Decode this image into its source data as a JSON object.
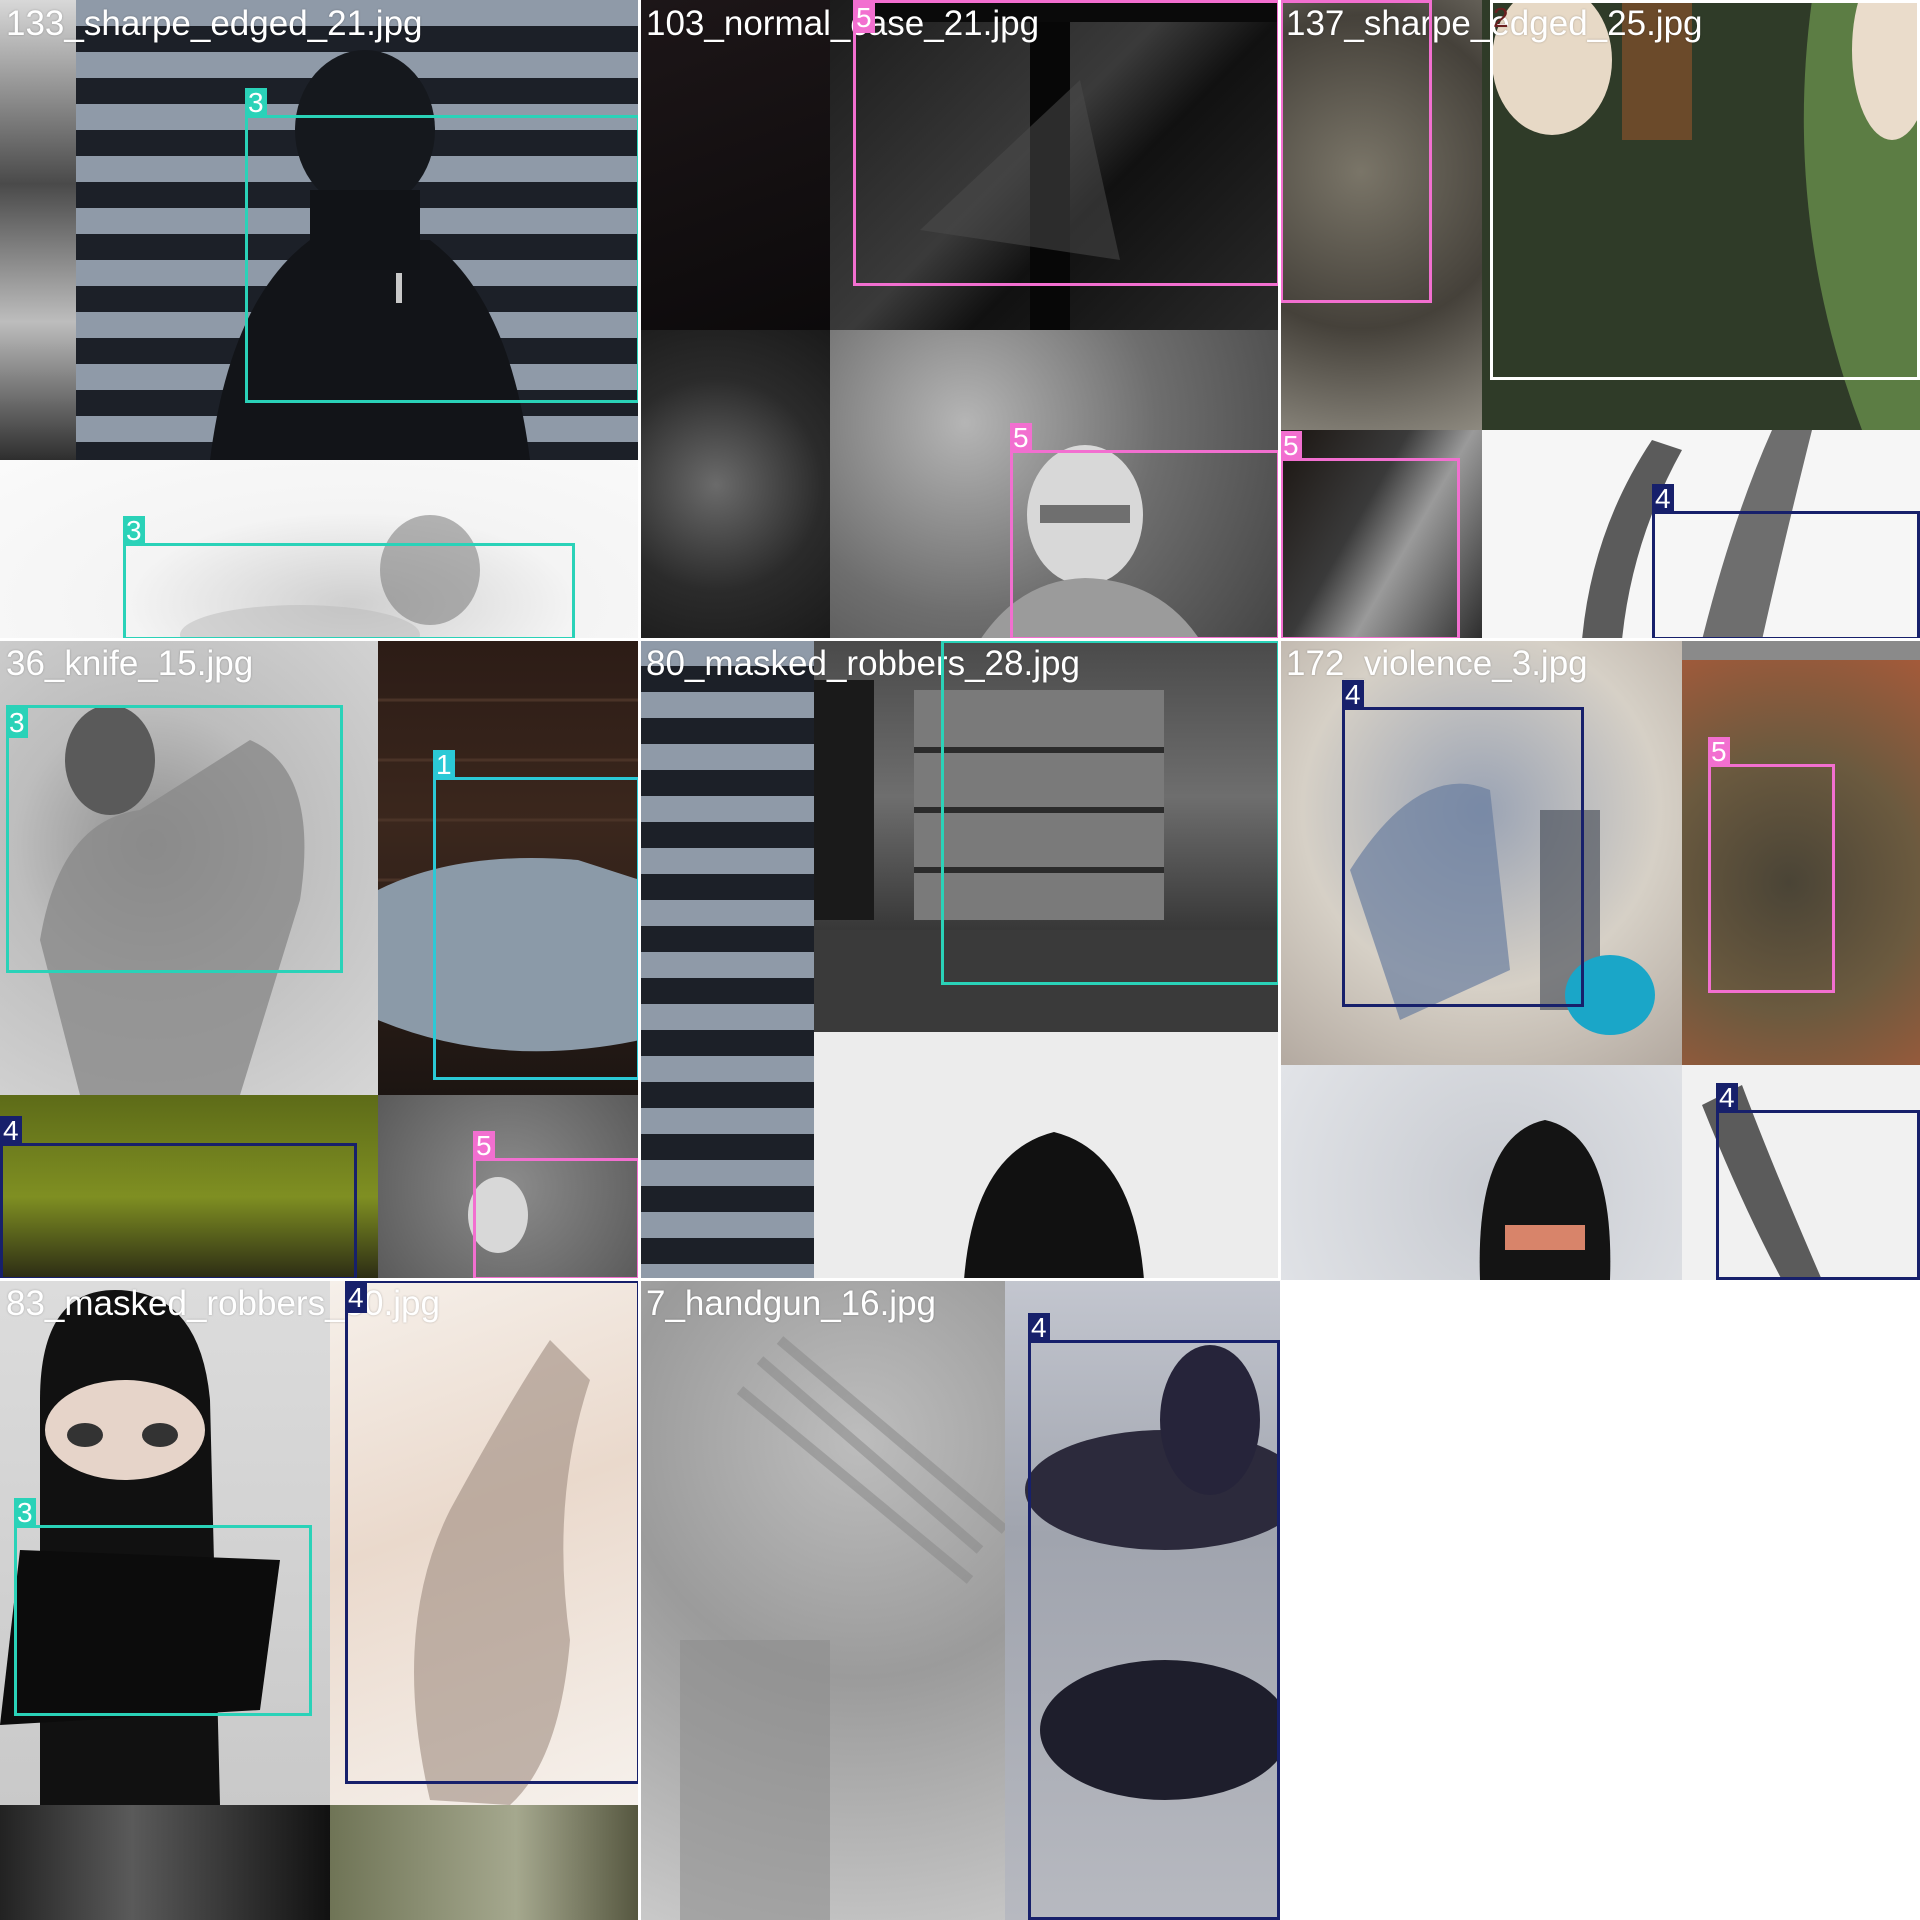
{
  "class_colors": {
    "1": "#2bc9d6",
    "2": "#ffffff",
    "3": "#2ad2b8",
    "4": "#17206b",
    "5": "#f26fd0"
  },
  "tiles": [
    {
      "filename": "133_sharpe_edged_21.jpg",
      "labels": [
        "3",
        "3"
      ]
    },
    {
      "filename": "103_normal_case_21.jpg",
      "labels": [
        "5",
        "5",
        "5",
        "5"
      ]
    },
    {
      "filename": "137_sharpe_edged_25.jpg",
      "labels": [
        "2",
        "5",
        "4"
      ]
    },
    {
      "filename": "36_knife_15.jpg",
      "labels": [
        "3",
        "1",
        "4",
        "5"
      ]
    },
    {
      "filename": "80_masked_robbers_28.jpg",
      "labels": [
        "3"
      ]
    },
    {
      "filename": "172_violence_3.jpg",
      "labels": [
        "4",
        "5",
        "4"
      ]
    },
    {
      "filename": "83_masked_robbers_30.jpg",
      "labels": [
        "3",
        "4"
      ]
    },
    {
      "filename": "7_handgun_16.jpg",
      "labels": [
        "4"
      ]
    }
  ]
}
